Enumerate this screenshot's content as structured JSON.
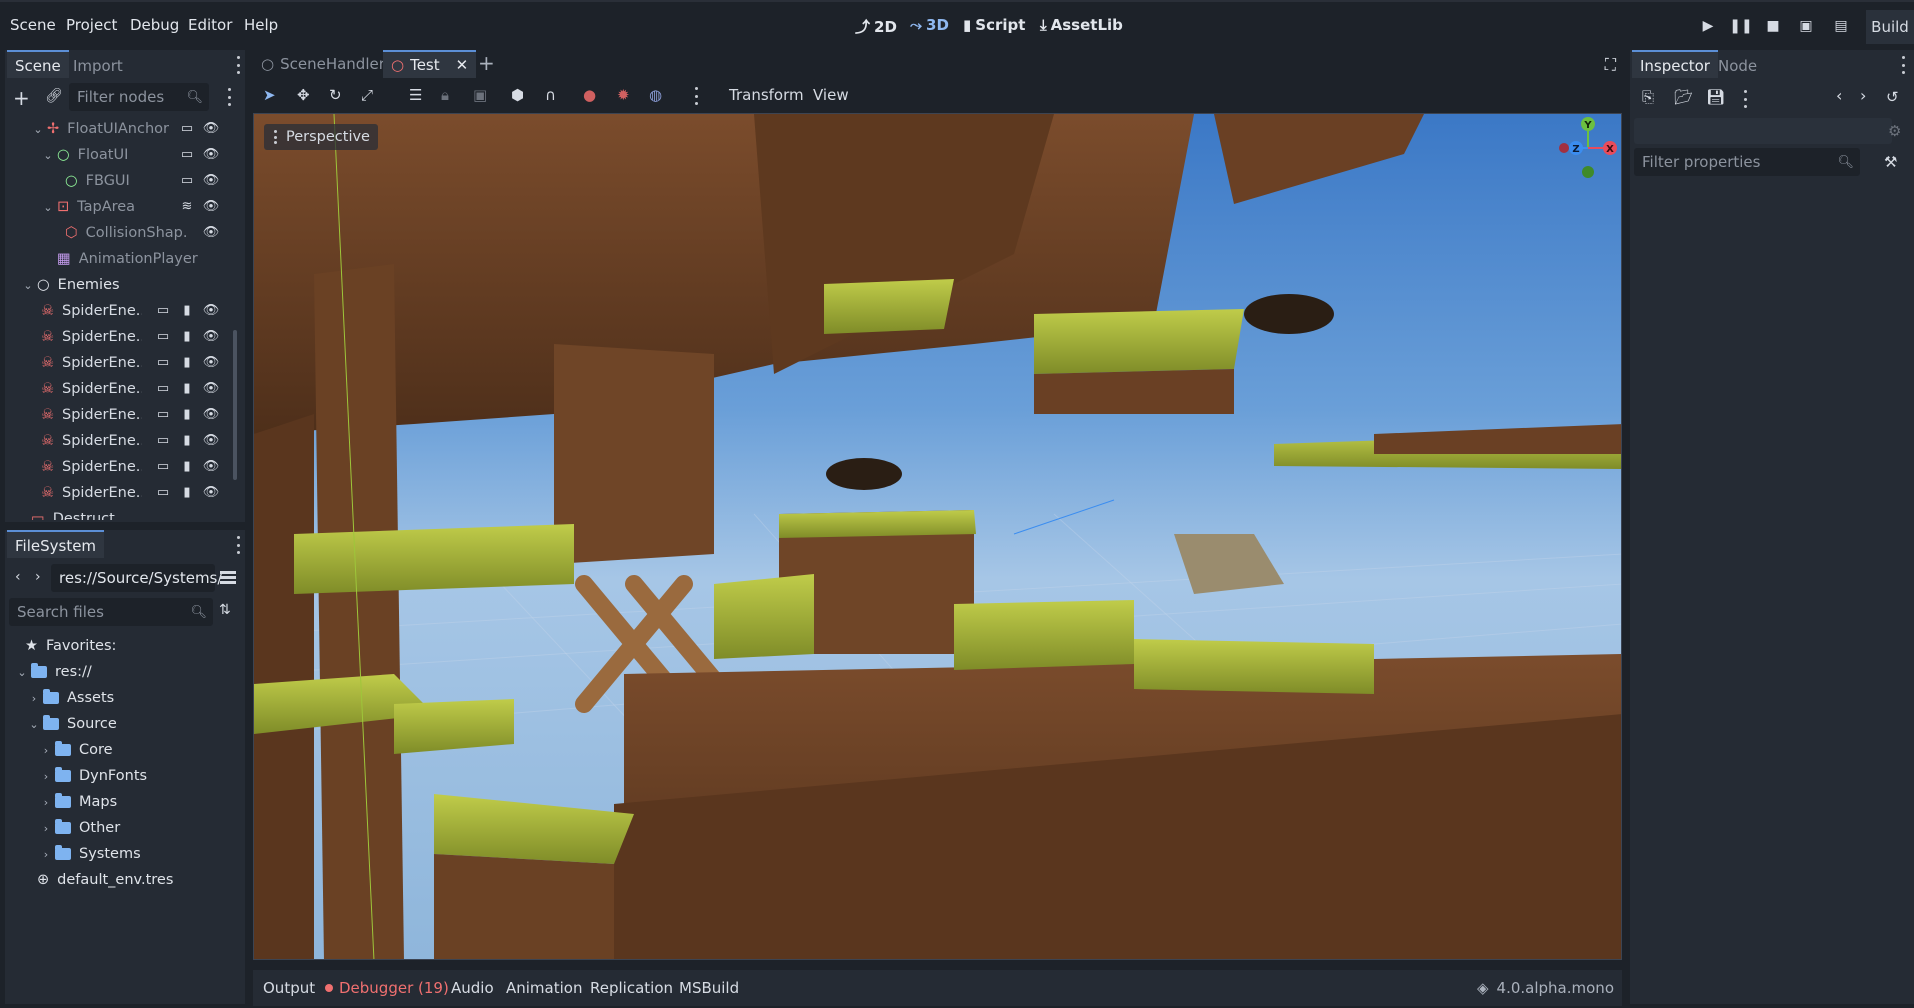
{
  "menu": [
    "Scene",
    "Project",
    "Debug",
    "Editor",
    "Help"
  ],
  "workspaces": [
    "2D",
    "3D",
    "Script",
    "AssetLib"
  ],
  "build_label": "Build",
  "scene_dock": {
    "tabs": [
      "Scene",
      "Import"
    ],
    "filter_placeholder": "Filter nodes",
    "nodes": [
      {
        "label": "FloatUIAnchor",
        "dim": true
      },
      {
        "label": "FloatUI",
        "dim": true
      },
      {
        "label": "FBGUI",
        "dim": true
      },
      {
        "label": "TapArea",
        "dim": true
      },
      {
        "label": "CollisionShap...",
        "dim": true
      },
      {
        "label": "AnimationPlayer",
        "dim": true
      },
      {
        "label": "Enemies",
        "dim": false
      },
      {
        "label": "SpiderEne...",
        "dim": false
      },
      {
        "label": "SpiderEne...",
        "dim": false
      },
      {
        "label": "SpiderEne...",
        "dim": false
      },
      {
        "label": "SpiderEne...",
        "dim": false
      },
      {
        "label": "SpiderEne...",
        "dim": false
      },
      {
        "label": "SpiderEne...",
        "dim": false
      },
      {
        "label": "SpiderEne...",
        "dim": false
      },
      {
        "label": "SpiderEne...",
        "dim": false
      },
      {
        "label": "Destruct...",
        "dim": false
      }
    ]
  },
  "filesystem": {
    "title": "FileSystem",
    "path": "res://Source/Systems/",
    "search_placeholder": "Search files",
    "items": [
      {
        "label": "Favorites:"
      },
      {
        "label": "res://"
      },
      {
        "label": "Assets"
      },
      {
        "label": "Source"
      },
      {
        "label": "Core"
      },
      {
        "label": "DynFonts"
      },
      {
        "label": "Maps"
      },
      {
        "label": "Other"
      },
      {
        "label": "Systems"
      },
      {
        "label": "default_env.tres"
      }
    ]
  },
  "editor_tabs": [
    "SceneHandler",
    "Test"
  ],
  "viewport_menu": {
    "transform": "Transform",
    "view": "View",
    "perspective": "Perspective"
  },
  "gizmo": {
    "y": "Y",
    "z": "Z",
    "x": "X"
  },
  "inspector": {
    "tabs": [
      "Inspector",
      "Node"
    ],
    "filter_placeholder": "Filter properties"
  },
  "bottom_panel": {
    "tabs": [
      "Output",
      "Debugger (19)",
      "Audio",
      "Animation",
      "Replication",
      "MSBuild"
    ],
    "version": "4.0.alpha.mono"
  },
  "colors": {
    "accent": "#5c8fd6",
    "debugger_red": "#f07070",
    "grass": "#a8b836",
    "wood": "#6b4326"
  }
}
